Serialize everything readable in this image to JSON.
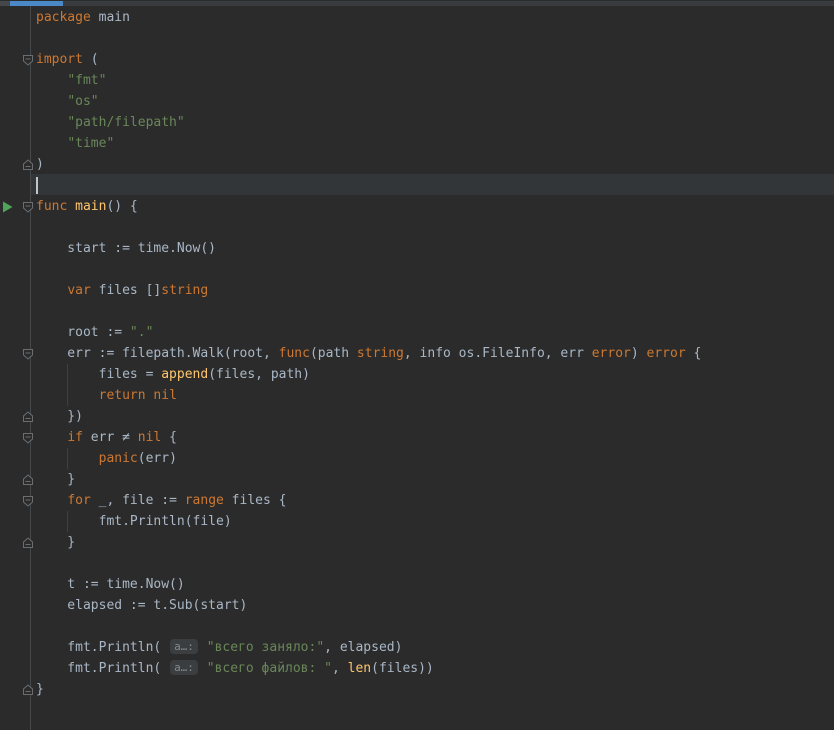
{
  "window": {
    "kind": "code-editor",
    "active_tab_underline_color": "#4a88c7"
  },
  "editor": {
    "language": "go",
    "caret_line": 9,
    "run_gutter_line": 10,
    "colors": {
      "background": "#2b2b2b",
      "caret_row": "#333638",
      "default_text": "#a9b7c6",
      "keyword": "#cc7832",
      "string": "#6a8759",
      "function": "#ffc66d",
      "builtin": "#ffc66d",
      "run_arrow": "#4fa45a",
      "fold_icon": "#6a6e71",
      "gutter_line": "#45494b",
      "inlay_bg": "#3b3e40",
      "inlay_text": "#868a8d"
    },
    "inlay_hint_label": "a…:",
    "fold_markers": [
      {
        "line": 3,
        "kind": "start"
      },
      {
        "line": 8,
        "kind": "end"
      },
      {
        "line": 10,
        "kind": "start"
      },
      {
        "line": 17,
        "kind": "start"
      },
      {
        "line": 20,
        "kind": "end"
      },
      {
        "line": 21,
        "kind": "start"
      },
      {
        "line": 23,
        "kind": "end"
      },
      {
        "line": 24,
        "kind": "start"
      },
      {
        "line": 26,
        "kind": "end"
      },
      {
        "line": 33,
        "kind": "end"
      }
    ],
    "indent_guides": [
      {
        "from_line": 18,
        "to_line": 19,
        "x": 67
      },
      {
        "from_line": 22,
        "to_line": 22,
        "x": 67
      },
      {
        "from_line": 25,
        "to_line": 25,
        "x": 67
      }
    ],
    "lines": [
      [
        {
          "t": "package",
          "c": "k"
        },
        {
          "t": " main",
          "c": "d"
        }
      ],
      [],
      [
        {
          "t": "import",
          "c": "k"
        },
        {
          "t": " (",
          "c": "d"
        }
      ],
      [
        {
          "t": "    ",
          "c": "d"
        },
        {
          "t": "\"fmt\"",
          "c": "s"
        }
      ],
      [
        {
          "t": "    ",
          "c": "d"
        },
        {
          "t": "\"os\"",
          "c": "s"
        }
      ],
      [
        {
          "t": "    ",
          "c": "d"
        },
        {
          "t": "\"path/filepath\"",
          "c": "s"
        }
      ],
      [
        {
          "t": "    ",
          "c": "d"
        },
        {
          "t": "\"time\"",
          "c": "s"
        }
      ],
      [
        {
          "t": ")",
          "c": "d"
        }
      ],
      [],
      [
        {
          "t": "func",
          "c": "k"
        },
        {
          "t": " ",
          "c": "d"
        },
        {
          "t": "main",
          "c": "f"
        },
        {
          "t": "() {",
          "c": "d"
        }
      ],
      [],
      [
        {
          "t": "    start := time.Now()",
          "c": "d"
        }
      ],
      [],
      [
        {
          "t": "    ",
          "c": "d"
        },
        {
          "t": "var",
          "c": "k"
        },
        {
          "t": " files []",
          "c": "d"
        },
        {
          "t": "string",
          "c": "k"
        }
      ],
      [],
      [
        {
          "t": "    root := ",
          "c": "d"
        },
        {
          "t": "\".\"",
          "c": "s"
        }
      ],
      [
        {
          "t": "    err := filepath.Walk(root, ",
          "c": "d"
        },
        {
          "t": "func",
          "c": "k"
        },
        {
          "t": "(path ",
          "c": "d"
        },
        {
          "t": "string",
          "c": "k"
        },
        {
          "t": ", info os.FileInfo, err ",
          "c": "d"
        },
        {
          "t": "error",
          "c": "k"
        },
        {
          "t": ") ",
          "c": "d"
        },
        {
          "t": "error",
          "c": "k"
        },
        {
          "t": " {",
          "c": "d"
        }
      ],
      [
        {
          "t": "        files = ",
          "c": "d"
        },
        {
          "t": "append",
          "c": "b"
        },
        {
          "t": "(files, path)",
          "c": "d"
        }
      ],
      [
        {
          "t": "        ",
          "c": "d"
        },
        {
          "t": "return",
          "c": "k"
        },
        {
          "t": " ",
          "c": "d"
        },
        {
          "t": "nil",
          "c": "k"
        }
      ],
      [
        {
          "t": "    })",
          "c": "d"
        }
      ],
      [
        {
          "t": "    ",
          "c": "d"
        },
        {
          "t": "if",
          "c": "k"
        },
        {
          "t": " err ≠ ",
          "c": "d"
        },
        {
          "t": "nil",
          "c": "k"
        },
        {
          "t": " {",
          "c": "d"
        }
      ],
      [
        {
          "t": "        ",
          "c": "d"
        },
        {
          "t": "panic",
          "c": "k"
        },
        {
          "t": "(err)",
          "c": "d"
        }
      ],
      [
        {
          "t": "    }",
          "c": "d"
        }
      ],
      [
        {
          "t": "    ",
          "c": "d"
        },
        {
          "t": "for",
          "c": "k"
        },
        {
          "t": " _, file := ",
          "c": "d"
        },
        {
          "t": "range",
          "c": "k"
        },
        {
          "t": " files {",
          "c": "d"
        }
      ],
      [
        {
          "t": "        fmt.Println(file)",
          "c": "d"
        }
      ],
      [
        {
          "t": "    }",
          "c": "d"
        }
      ],
      [],
      [
        {
          "t": "    t := time.Now()",
          "c": "d"
        }
      ],
      [
        {
          "t": "    elapsed := t.Sub(start)",
          "c": "d"
        }
      ],
      [],
      [
        {
          "t": "    fmt.Println( ",
          "c": "d"
        },
        {
          "t": "a…:",
          "c": "inlay"
        },
        {
          "t": " ",
          "c": "d"
        },
        {
          "t": "\"всего заняло:\"",
          "c": "s"
        },
        {
          "t": ", elapsed)",
          "c": "d"
        }
      ],
      [
        {
          "t": "    fmt.Println( ",
          "c": "d"
        },
        {
          "t": "a…:",
          "c": "inlay"
        },
        {
          "t": " ",
          "c": "d"
        },
        {
          "t": "\"всего файлов: \"",
          "c": "s"
        },
        {
          "t": ", ",
          "c": "d"
        },
        {
          "t": "len",
          "c": "b"
        },
        {
          "t": "(files))",
          "c": "d"
        }
      ],
      [
        {
          "t": "}",
          "c": "d"
        }
      ],
      []
    ]
  }
}
